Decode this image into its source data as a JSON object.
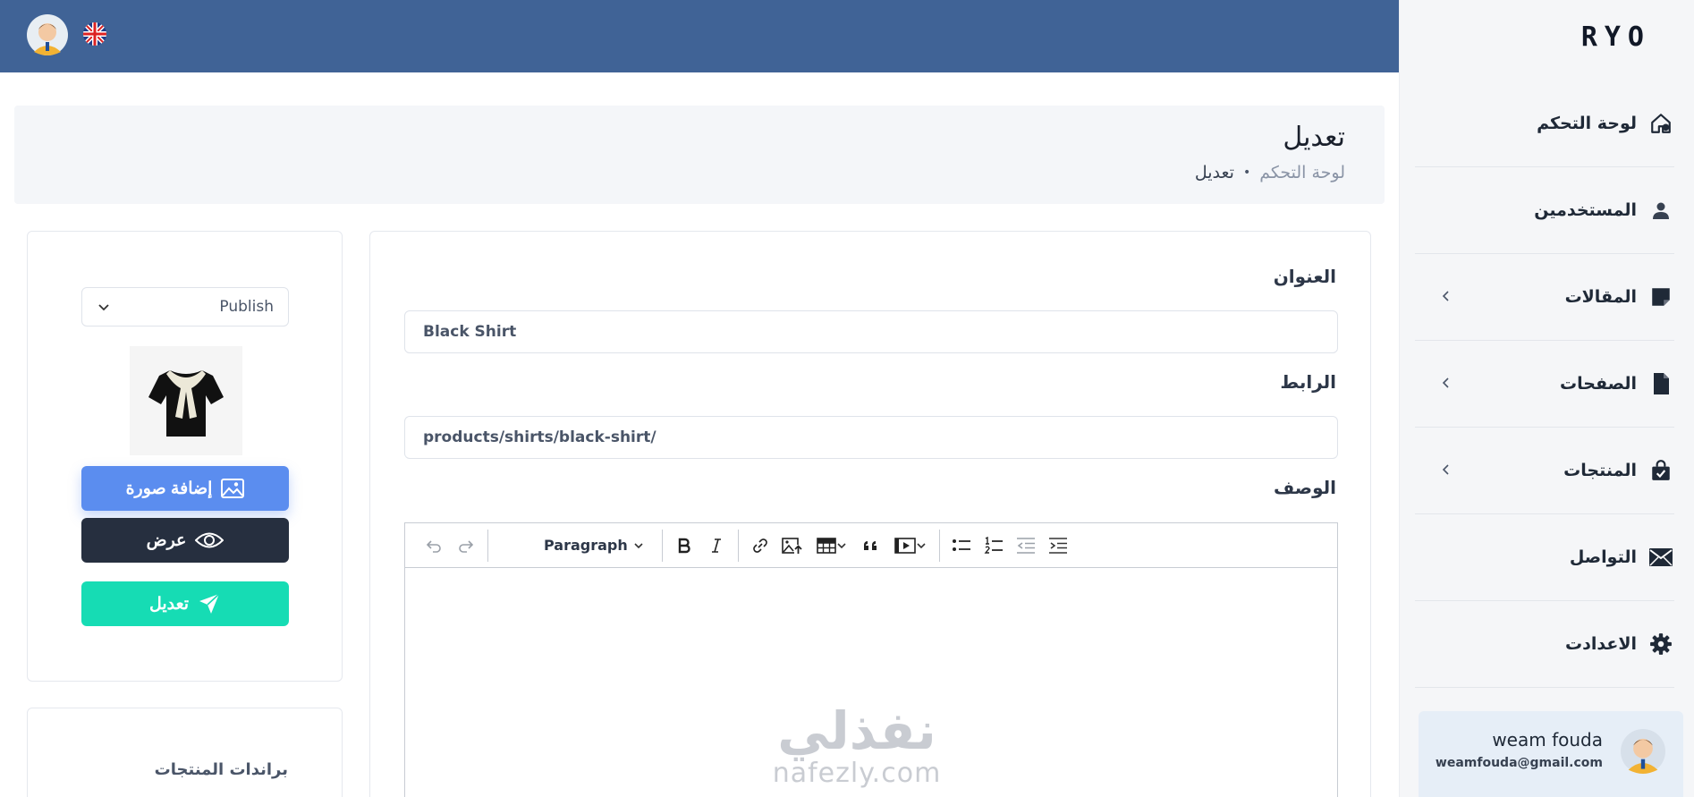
{
  "sidebar": {
    "logo": "RYO",
    "items": [
      {
        "label": "لوحة التحكم",
        "icon": "home-icon",
        "has_submenu": false
      },
      {
        "label": "المستخدمين",
        "icon": "user-icon",
        "has_submenu": false
      },
      {
        "label": "المقالات",
        "icon": "note-icon",
        "has_submenu": true
      },
      {
        "label": "الصفحات",
        "icon": "file-icon",
        "has_submenu": true
      },
      {
        "label": "المنتجات",
        "icon": "shopping-bag-icon",
        "has_submenu": true
      },
      {
        "label": "التواصل",
        "icon": "mail-icon",
        "has_submenu": false
      },
      {
        "label": "الاعدادت",
        "icon": "gear-icon",
        "has_submenu": false
      }
    ],
    "user": {
      "name": "weam fouda",
      "email": "weamfouda@gmail.com"
    }
  },
  "topbar": {
    "language_icon": "uk-flag-icon"
  },
  "header": {
    "title": "تعديل",
    "breadcrumb": {
      "link": "لوحة التحكم",
      "separator": "•",
      "current": "تعديل"
    }
  },
  "form": {
    "title_label": "العنوان",
    "title_value": "Black Shirt",
    "slug_label": "الرابط",
    "slug_value": "products/shirts/black-shirt/",
    "description_label": "الوصف",
    "editor": {
      "paragraph_label": "Paragraph"
    }
  },
  "side": {
    "status_value": "Publish",
    "add_image_label": "إضافة صورة",
    "view_label": "عرض",
    "edit_label": "تعديل",
    "brands_title": "براندات المنتجات"
  },
  "watermark": {
    "arabic": "نفذلي",
    "latin": "nafezly.com"
  },
  "colors": {
    "topbar": "#406396",
    "add_button": "#5b8def",
    "view_button": "#262f3f",
    "edit_button": "#16dcb4"
  }
}
